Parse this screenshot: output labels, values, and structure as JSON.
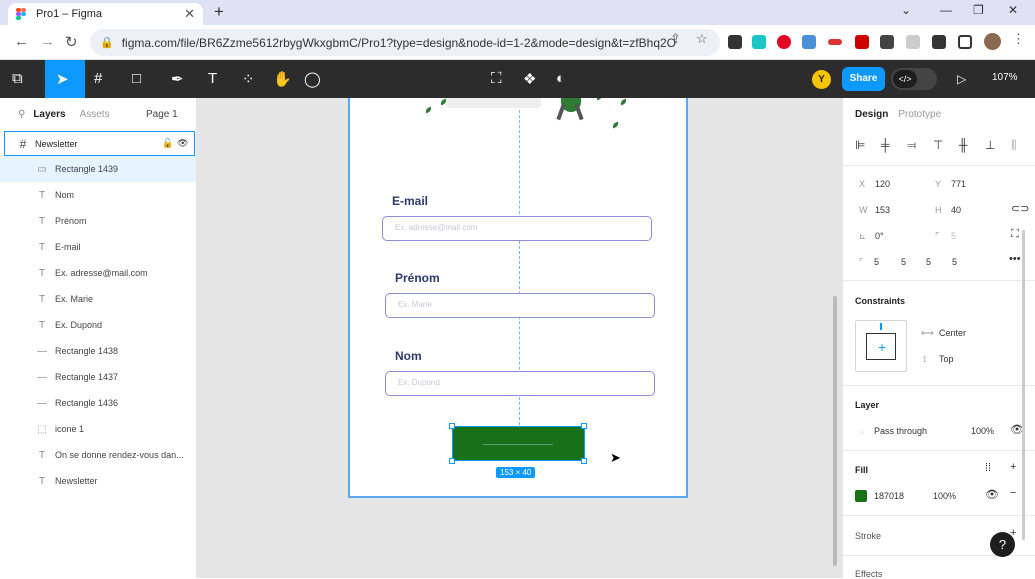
{
  "browser": {
    "tab_title": "Pro1 – Figma",
    "url": "figma.com/file/BR6Zzme5612rbygWkxgbmC/Pro1?type=design&node-id=1-2&mode=design&t=zfBhq2O..."
  },
  "toolbar": {
    "avatar_initial": "Y",
    "share_label": "Share",
    "zoom_level": "107%"
  },
  "layers_panel": {
    "tab_layers": "Layers",
    "tab_assets": "Assets",
    "page": "Page 1",
    "frame_name": "Newsletter",
    "items": [
      {
        "icon": "rectangle-icon",
        "name": "Rectangle 1439"
      },
      {
        "icon": "text-icon",
        "name": "Nom"
      },
      {
        "icon": "text-icon",
        "name": "Prénom"
      },
      {
        "icon": "text-icon",
        "name": "E-mail"
      },
      {
        "icon": "text-icon",
        "name": "Ex. adresse@mail.com"
      },
      {
        "icon": "text-icon",
        "name": "Ex. Marie"
      },
      {
        "icon": "text-icon",
        "name": "Ex. Dupond"
      },
      {
        "icon": "line-icon",
        "name": "Rectangle 1438"
      },
      {
        "icon": "line-icon",
        "name": "Rectangle 1437"
      },
      {
        "icon": "line-icon",
        "name": "Rectangle 1436"
      },
      {
        "icon": "component-icon",
        "name": "icone 1"
      },
      {
        "icon": "text-icon",
        "name": "On se donne rendez-vous dan..."
      },
      {
        "icon": "text-icon",
        "name": "Newsletter"
      }
    ]
  },
  "canvas": {
    "email_label": "E-mail",
    "email_placeholder": "Ex. adresse@mail.com",
    "prenom_label": "Prénom",
    "prenom_placeholder": "Ex. Marie",
    "nom_label": "Nom",
    "nom_placeholder": "Ex. Dupond",
    "selection_size": "153 × 40",
    "button_color": "#187018"
  },
  "design_panel": {
    "tab_design": "Design",
    "tab_prototype": "Prototype",
    "x_label": "X",
    "x": "120",
    "y_label": "Y",
    "y": "771",
    "w_label": "W",
    "w": "153",
    "h_label": "H",
    "h": "40",
    "rotation": "0°",
    "radius": "5",
    "radii": [
      "5",
      "5",
      "5",
      "5"
    ],
    "constraints_title": "Constraints",
    "constraint_h": "Center",
    "constraint_v": "Top",
    "layer_title": "Layer",
    "blend_mode": "Pass through",
    "layer_opacity": "100%",
    "fill_title": "Fill",
    "fill_hex": "187018",
    "fill_opacity": "100%",
    "stroke_title": "Stroke",
    "effects_title": "Effects"
  }
}
